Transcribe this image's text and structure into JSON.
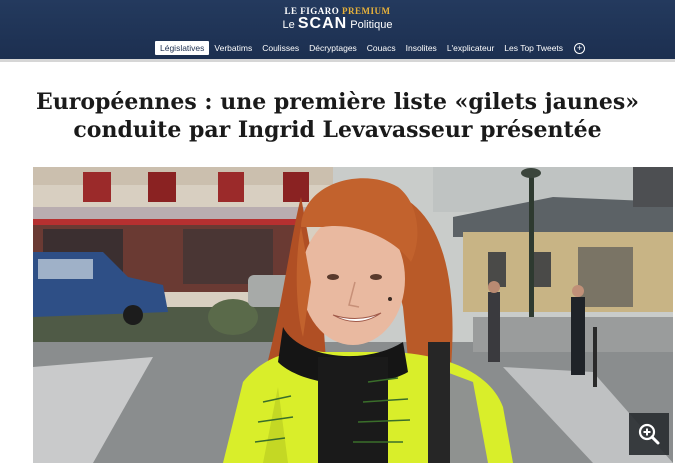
{
  "header": {
    "brand_top_left": "LE FIGARO",
    "brand_top_right": "PREMIUM",
    "brand_le": "Le",
    "brand_scan": "SCAN",
    "brand_politique": "Politique",
    "brand_color": "#1c2f50",
    "premium_color": "#e8b23a"
  },
  "nav": {
    "items": [
      {
        "label": "Législatives",
        "active": true
      },
      {
        "label": "Verbatims"
      },
      {
        "label": "Coulisses"
      },
      {
        "label": "Décryptages"
      },
      {
        "label": "Couacs"
      },
      {
        "label": "Insolites"
      },
      {
        "label": "L'explicateur"
      },
      {
        "label": "Les Top Tweets"
      }
    ],
    "more_icon": "plus-circle-icon"
  },
  "article": {
    "title_line1": "Européennes : une première liste «gilets jaunes»",
    "title_line2": "conduite par Ingrid Levavasseur présentée"
  },
  "photo": {
    "vest_color": "#d9ee2a",
    "hair_color": "#c8582a",
    "zoom_icon": "zoom-in-icon"
  }
}
